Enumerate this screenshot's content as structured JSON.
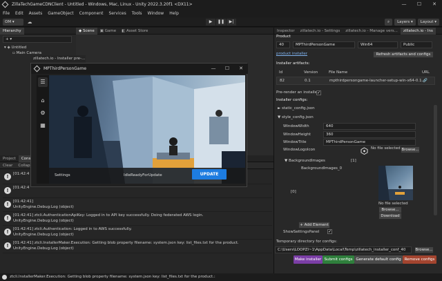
{
  "window": {
    "title": "ZillaTechGameCDNClient - Untitled - Windows, Mac, Linux - Unity 2022.3.20f1 <DX11>",
    "controls": [
      "—",
      "☐",
      "✕"
    ]
  },
  "menu": [
    "File",
    "Edit",
    "Assets",
    "GameObject",
    "Component",
    "Services",
    "Tools",
    "Window",
    "Help"
  ],
  "toolbar": {
    "account": "OM ▾",
    "play_controls": [
      "▶",
      "❚❚",
      "▶|"
    ],
    "layers": "Layers ▾",
    "layout": "Layout ▾"
  },
  "hierarchy": {
    "tab": "Hierarchy",
    "scene": "Untitled",
    "items": [
      "Main Camera"
    ]
  },
  "center_tabs": [
    "Scene",
    "Game",
    "Asset Store"
  ],
  "installer_tab": "zillatech.io - Installer pre-...",
  "console": {
    "tabs": [
      "Project",
      "Console"
    ],
    "toolbar": [
      "Clear",
      "Collapse"
    ],
    "logs": [
      {
        "line1": "[01:42:4",
        "line2": ""
      },
      {
        "line1": "[01:42:4",
        "line2": ""
      },
      {
        "line1": "[01:42:41]",
        "line2": "UnityEngine.Debug:Log (object)"
      },
      {
        "line1": "[01:42:41] ztcli.AuthenticationApiKey: Logged in to API key successfully. Doing federated AWS login.",
        "line2": "UnityEngine.Debug:Log (object)"
      },
      {
        "line1": "[01:42:41] ztcli.Authentication: Logged in to AWS successfully.",
        "line2": "UnityEngine.Debug:Log (object)"
      },
      {
        "line1": "[01:42:41] ztcli.InstallerMaker.Execution: Getting blob property filename: system.json key: list_files.txt for the product.",
        "line2": "UnityEngine.Debug:Log (object)"
      }
    ]
  },
  "status_bar": "ztcli.InstallerMaker.Execution: Getting blob property filename: system.json key: list_files.txt for the product.:",
  "dialog": {
    "title": "MPThirdPersonGame",
    "controls": [
      "—",
      "☐",
      "✕"
    ],
    "footer_left": "Settings",
    "footer_status": "IdleReadyForUpdate",
    "update_button": "UPDATE"
  },
  "inspector": {
    "tabs": [
      "Inspector",
      "zillatech.io - Settings",
      "zillatech.io - Manage vers...",
      "zillatech.io - Ins"
    ],
    "product_label": "Product",
    "product": {
      "id": "40",
      "name": "MPThirdPersonGame",
      "platform": "Win64",
      "visibility": "Public"
    },
    "product_link": "product installer",
    "refresh_button": "Refresh artifacts and configs",
    "artifacts_label": "Installer artifacts:",
    "artifacts_columns": [
      "Id",
      "Version",
      "File Name",
      "URL"
    ],
    "artifact_row": {
      "id": "82",
      "version": "0.1",
      "file": "mpthirdpersongame-launcher-setup-win-x64-0.1...",
      "url": "🔗"
    },
    "prerender_label": "Pre-render an installer",
    "prerender_checked": "✓",
    "configs_label": "Installer configs:",
    "static_config": "static_config.json",
    "style_config": "style_config.json",
    "window_width_label": "WindowWidth",
    "window_width": "640",
    "window_height_label": "WindowHeight",
    "window_height": "360",
    "window_title_label": "WindowTitle",
    "window_title": "MPThirdPersonGame",
    "logo_label": "WindowLogoIcon",
    "no_file": "No file selected",
    "browse": "Browse...",
    "bg_images_label": "BackgroundImages",
    "bg_images_count": "[1]",
    "bg_image_item": "BackgroundImages_0",
    "bg_index": "[0]",
    "no_file2": "No file selected",
    "browse2": "Browse...",
    "download": "Download",
    "add_element": "+ Add Element",
    "show_settings_label": "ShowSettingsPanel",
    "show_settings_checked": "✓",
    "temp_dir_label": "Temporary directory for configs:",
    "temp_dir": "C:\\Users\\LOOPZI~1\\AppData\\Local\\Temp\\zillatech_installer_conf_40",
    "browse3": "Browse...",
    "actions": [
      "Make installer",
      "Submit configs",
      "Generate default config",
      "Remove configs"
    ],
    "colors": {
      "make": "#7b3ea6",
      "submit": "#2f7f3c",
      "generate": "#4a4a4a",
      "remove": "#a3442f"
    }
  }
}
